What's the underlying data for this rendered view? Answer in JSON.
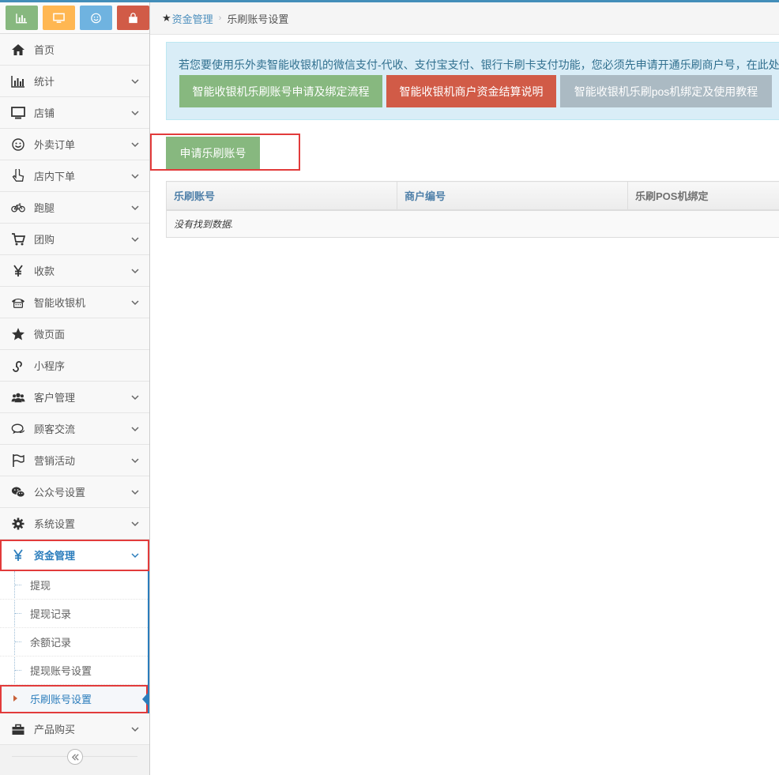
{
  "shortcuts": [
    {
      "icon": "bar-chart-icon",
      "color": "#87b87f"
    },
    {
      "icon": "desktop-icon",
      "color": "#ffb752"
    },
    {
      "icon": "smile-icon",
      "color": "#6fb3e0"
    },
    {
      "icon": "shopping-bag-icon",
      "color": "#d15b47"
    }
  ],
  "sidebar": {
    "items": [
      {
        "label": "首页",
        "icon": "home-icon"
      },
      {
        "label": "统计",
        "icon": "bar-chart-icon"
      },
      {
        "label": "店铺",
        "icon": "desktop-icon"
      },
      {
        "label": "外卖订单",
        "icon": "smile-icon"
      },
      {
        "label": "店内下单",
        "icon": "hand-pointer-icon"
      },
      {
        "label": "跑腿",
        "icon": "bicycle-icon"
      },
      {
        "label": "团购",
        "icon": "cart-icon"
      },
      {
        "label": "收款",
        "icon": "yen-icon"
      },
      {
        "label": "智能收银机",
        "icon": "phone-icon"
      },
      {
        "label": "微页面",
        "icon": "star-icon"
      },
      {
        "label": "小程序",
        "icon": "miniprogram-icon"
      },
      {
        "label": "客户管理",
        "icon": "users-icon"
      },
      {
        "label": "顾客交流",
        "icon": "chat-icon"
      },
      {
        "label": "营销活动",
        "icon": "flag-icon"
      },
      {
        "label": "公众号设置",
        "icon": "wechat-icon"
      },
      {
        "label": "系统设置",
        "icon": "gear-icon"
      },
      {
        "label": "资金管理",
        "icon": "yen-icon"
      }
    ],
    "submenu": [
      {
        "label": "提现"
      },
      {
        "label": "提现记录"
      },
      {
        "label": "余额记录"
      },
      {
        "label": "提现账号设置"
      },
      {
        "label": "乐刷账号设置"
      }
    ],
    "after": {
      "label": "产品购买",
      "icon": "briefcase-icon"
    }
  },
  "breadcrumb": {
    "parent": "资金管理",
    "current": "乐刷账号设置"
  },
  "alert": {
    "text": "若您要使用乐外卖智能收银机的微信支付-代收、支付宝支付、银行卡刷卡支付功能，您必须先申请开通乐刷商户号，在此处",
    "buttons": [
      "智能收银机乐刷账号申请及绑定流程",
      "智能收银机商户资金结算说明",
      "智能收银机乐刷pos机绑定及使用教程"
    ]
  },
  "apply_button": "申请乐刷账号",
  "table": {
    "headers": [
      "乐刷账号",
      "商户编号",
      "乐刷POS机绑定"
    ],
    "empty_text": "没有找到数据."
  },
  "colors": {
    "accent": "#2b7dbc",
    "green": "#87b87f",
    "red": "#d15b47",
    "gray": "#abbac3",
    "highlight": "#e23b3b"
  }
}
